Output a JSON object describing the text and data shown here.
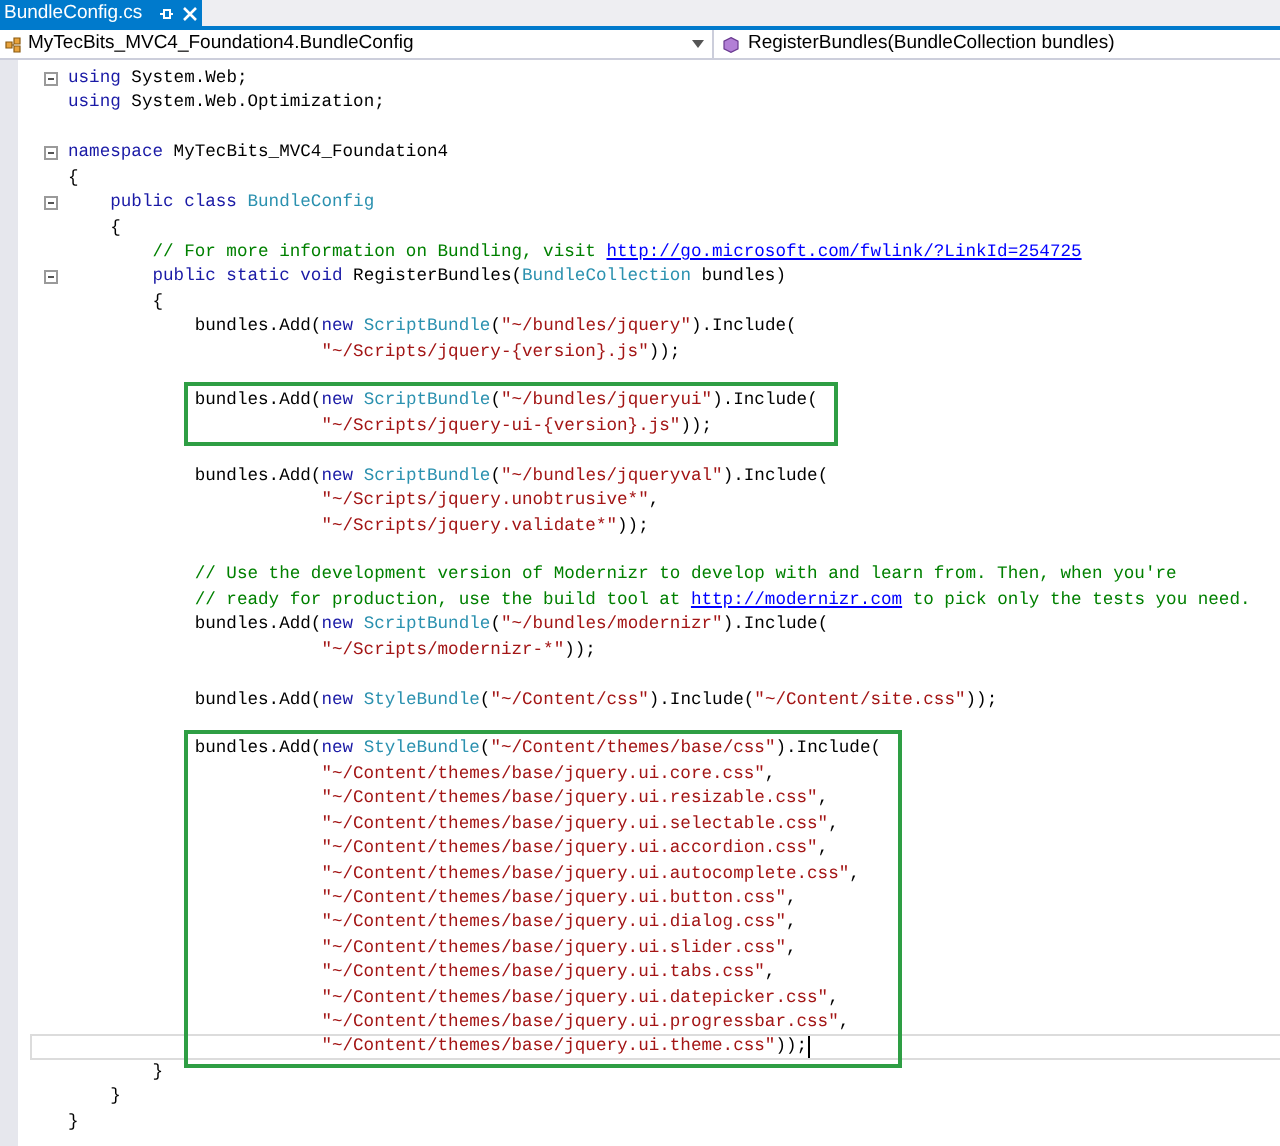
{
  "tab": {
    "title": "BundleConfig.cs",
    "selected": true
  },
  "nav": {
    "type_dropdown": "MyTecBits_MVC4_Foundation4.BundleConfig",
    "member_dropdown": "RegisterBundles(BundleCollection bundles)"
  },
  "blocks": [
    {
      "highlighted": false,
      "lines": [
        {
          "fold": true,
          "current": false,
          "tokens": [
            {
              "kind": "keyword",
              "text": "using"
            },
            {
              "kind": "plain",
              "text": " System.Web;"
            }
          ]
        },
        {
          "fold": false,
          "current": false,
          "tokens": [
            {
              "kind": "keyword",
              "text": "using"
            },
            {
              "kind": "plain",
              "text": " System.Web.Optimization;"
            }
          ]
        },
        {
          "fold": false,
          "current": false
        },
        {
          "fold": true,
          "current": false,
          "tokens": [
            {
              "kind": "keyword",
              "text": "namespace"
            },
            {
              "kind": "plain",
              "text": " MyTecBits_MVC4_Foundation4"
            }
          ]
        },
        {
          "fold": false,
          "current": false,
          "tokens": [
            {
              "kind": "plain",
              "text": "{"
            }
          ]
        },
        {
          "fold": true,
          "current": false,
          "tokens": [
            {
              "kind": "keyword",
              "text": "    public class"
            },
            {
              "kind": "type",
              "text": " BundleConfig"
            }
          ]
        },
        {
          "fold": false,
          "current": false,
          "tokens": [
            {
              "kind": "plain",
              "text": "    {"
            }
          ]
        },
        {
          "fold": false,
          "current": false,
          "tokens": [
            {
              "kind": "comment",
              "text": "        // For more information on Bundling, visit "
            },
            {
              "kind": "link",
              "text": "http://go.microsoft.com/fwlink/?LinkId=254725"
            }
          ]
        },
        {
          "fold": true,
          "current": false,
          "tokens": [
            {
              "kind": "keyword",
              "text": "        public static void"
            },
            {
              "kind": "plain",
              "text": " RegisterBundles("
            },
            {
              "kind": "type",
              "text": "BundleCollection"
            },
            {
              "kind": "plain",
              "text": " bundles)"
            }
          ]
        },
        {
          "fold": false,
          "current": false,
          "tokens": [
            {
              "kind": "plain",
              "text": "        {"
            }
          ]
        },
        {
          "fold": false,
          "current": false,
          "tokens": [
            {
              "kind": "plain",
              "text": "            bundles.Add("
            },
            {
              "kind": "keyword",
              "text": "new"
            },
            {
              "kind": "type",
              "text": " ScriptBundle"
            },
            {
              "kind": "plain",
              "text": "("
            },
            {
              "kind": "string",
              "text": "\"~/bundles/jquery\""
            },
            {
              "kind": "plain",
              "text": ").Include("
            }
          ]
        },
        {
          "fold": false,
          "current": false,
          "tokens": [
            {
              "kind": "string",
              "text": "                        \"~/Scripts/jquery-{version}.js\""
            },
            {
              "kind": "plain",
              "text": "));"
            }
          ]
        },
        {
          "fold": false,
          "current": false
        }
      ]
    },
    {
      "highlighted": true,
      "lines": [
        {
          "fold": false,
          "current": false,
          "tokens": [
            {
              "kind": "plain",
              "text": "            bundles.Add("
            },
            {
              "kind": "keyword",
              "text": "new"
            },
            {
              "kind": "type",
              "text": " ScriptBundle"
            },
            {
              "kind": "plain",
              "text": "("
            },
            {
              "kind": "string",
              "text": "\"~/bundles/jqueryui\""
            },
            {
              "kind": "plain",
              "text": ").Include("
            }
          ]
        },
        {
          "fold": false,
          "current": false,
          "tokens": [
            {
              "kind": "string",
              "text": "                        \"~/Scripts/jquery-ui-{version}.js\""
            },
            {
              "kind": "plain",
              "text": "));"
            }
          ]
        }
      ]
    },
    {
      "highlighted": false,
      "lines": [
        {
          "fold": false,
          "current": false
        },
        {
          "fold": false,
          "current": false,
          "tokens": [
            {
              "kind": "plain",
              "text": "            bundles.Add("
            },
            {
              "kind": "keyword",
              "text": "new"
            },
            {
              "kind": "type",
              "text": " ScriptBundle"
            },
            {
              "kind": "plain",
              "text": "("
            },
            {
              "kind": "string",
              "text": "\"~/bundles/jqueryval\""
            },
            {
              "kind": "plain",
              "text": ").Include("
            }
          ]
        },
        {
          "fold": false,
          "current": false,
          "tokens": [
            {
              "kind": "string",
              "text": "                        \"~/Scripts/jquery.unobtrusive*\""
            },
            {
              "kind": "plain",
              "text": ","
            }
          ]
        },
        {
          "fold": false,
          "current": false,
          "tokens": [
            {
              "kind": "string",
              "text": "                        \"~/Scripts/jquery.validate*\""
            },
            {
              "kind": "plain",
              "text": "));"
            }
          ]
        },
        {
          "fold": false,
          "current": false
        },
        {
          "fold": false,
          "current": false,
          "tokens": [
            {
              "kind": "comment",
              "text": "            // Use the development version of Modernizr to develop with and learn from. Then, when you're"
            }
          ]
        },
        {
          "fold": false,
          "current": false,
          "tokens": [
            {
              "kind": "comment",
              "text": "            // ready for production, use the build tool at "
            },
            {
              "kind": "link",
              "text": "http://modernizr.com"
            },
            {
              "kind": "comment",
              "text": " to pick only the tests you need."
            }
          ]
        },
        {
          "fold": false,
          "current": false,
          "tokens": [
            {
              "kind": "plain",
              "text": "            bundles.Add("
            },
            {
              "kind": "keyword",
              "text": "new"
            },
            {
              "kind": "type",
              "text": " ScriptBundle"
            },
            {
              "kind": "plain",
              "text": "("
            },
            {
              "kind": "string",
              "text": "\"~/bundles/modernizr\""
            },
            {
              "kind": "plain",
              "text": ").Include("
            }
          ]
        },
        {
          "fold": false,
          "current": false,
          "tokens": [
            {
              "kind": "string",
              "text": "                        \"~/Scripts/modernizr-*\""
            },
            {
              "kind": "plain",
              "text": "));"
            }
          ]
        },
        {
          "fold": false,
          "current": false
        },
        {
          "fold": false,
          "current": false,
          "tokens": [
            {
              "kind": "plain",
              "text": "            bundles.Add("
            },
            {
              "kind": "keyword",
              "text": "new"
            },
            {
              "kind": "type",
              "text": " StyleBundle"
            },
            {
              "kind": "plain",
              "text": "("
            },
            {
              "kind": "string",
              "text": "\"~/Content/css\""
            },
            {
              "kind": "plain",
              "text": ").Include("
            },
            {
              "kind": "string",
              "text": "\"~/Content/site.css\""
            },
            {
              "kind": "plain",
              "text": "));"
            }
          ]
        },
        {
          "fold": false,
          "current": false
        }
      ]
    },
    {
      "highlighted": true,
      "lines": [
        {
          "fold": false,
          "current": false,
          "tokens": [
            {
              "kind": "plain",
              "text": "            bundles.Add("
            },
            {
              "kind": "keyword",
              "text": "new"
            },
            {
              "kind": "type",
              "text": " StyleBundle"
            },
            {
              "kind": "plain",
              "text": "("
            },
            {
              "kind": "string",
              "text": "\"~/Content/themes/base/css\""
            },
            {
              "kind": "plain",
              "text": ").Include("
            }
          ]
        },
        {
          "fold": false,
          "current": false,
          "tokens": [
            {
              "kind": "string",
              "text": "                        \"~/Content/themes/base/jquery.ui.core.css\""
            },
            {
              "kind": "plain",
              "text": ","
            }
          ]
        },
        {
          "fold": false,
          "current": false,
          "tokens": [
            {
              "kind": "string",
              "text": "                        \"~/Content/themes/base/jquery.ui.resizable.css\""
            },
            {
              "kind": "plain",
              "text": ","
            }
          ]
        },
        {
          "fold": false,
          "current": false,
          "tokens": [
            {
              "kind": "string",
              "text": "                        \"~/Content/themes/base/jquery.ui.selectable.css\""
            },
            {
              "kind": "plain",
              "text": ","
            }
          ]
        },
        {
          "fold": false,
          "current": false,
          "tokens": [
            {
              "kind": "string",
              "text": "                        \"~/Content/themes/base/jquery.ui.accordion.css\""
            },
            {
              "kind": "plain",
              "text": ","
            }
          ]
        },
        {
          "fold": false,
          "current": false,
          "tokens": [
            {
              "kind": "string",
              "text": "                        \"~/Content/themes/base/jquery.ui.autocomplete.css\""
            },
            {
              "kind": "plain",
              "text": ","
            }
          ]
        },
        {
          "fold": false,
          "current": false,
          "tokens": [
            {
              "kind": "string",
              "text": "                        \"~/Content/themes/base/jquery.ui.button.css\""
            },
            {
              "kind": "plain",
              "text": ","
            }
          ]
        },
        {
          "fold": false,
          "current": false,
          "tokens": [
            {
              "kind": "string",
              "text": "                        \"~/Content/themes/base/jquery.ui.dialog.css\""
            },
            {
              "kind": "plain",
              "text": ","
            }
          ]
        },
        {
          "fold": false,
          "current": false,
          "tokens": [
            {
              "kind": "string",
              "text": "                        \"~/Content/themes/base/jquery.ui.slider.css\""
            },
            {
              "kind": "plain",
              "text": ","
            }
          ]
        },
        {
          "fold": false,
          "current": false,
          "tokens": [
            {
              "kind": "string",
              "text": "                        \"~/Content/themes/base/jquery.ui.tabs.css\""
            },
            {
              "kind": "plain",
              "text": ","
            }
          ]
        },
        {
          "fold": false,
          "current": false,
          "tokens": [
            {
              "kind": "string",
              "text": "                        \"~/Content/themes/base/jquery.ui.datepicker.css\""
            },
            {
              "kind": "plain",
              "text": ","
            }
          ]
        },
        {
          "fold": false,
          "current": false,
          "tokens": [
            {
              "kind": "string",
              "text": "                        \"~/Content/themes/base/jquery.ui.progressbar.css\""
            },
            {
              "kind": "plain",
              "text": ","
            }
          ]
        },
        {
          "fold": false,
          "current": true,
          "tokens": [
            {
              "kind": "string",
              "text": "                        \"~/Content/themes/base/jquery.ui.theme.css\""
            },
            {
              "kind": "plain",
              "text": "));"
            }
          ]
        }
      ]
    },
    {
      "highlighted": false,
      "lines": [
        {
          "fold": false,
          "current": false,
          "tokens": [
            {
              "kind": "plain",
              "text": "        }"
            }
          ]
        },
        {
          "fold": false,
          "current": false,
          "tokens": [
            {
              "kind": "plain",
              "text": "    }"
            }
          ]
        },
        {
          "fold": false,
          "current": false,
          "tokens": [
            {
              "kind": "plain",
              "text": "}"
            }
          ]
        }
      ]
    }
  ]
}
